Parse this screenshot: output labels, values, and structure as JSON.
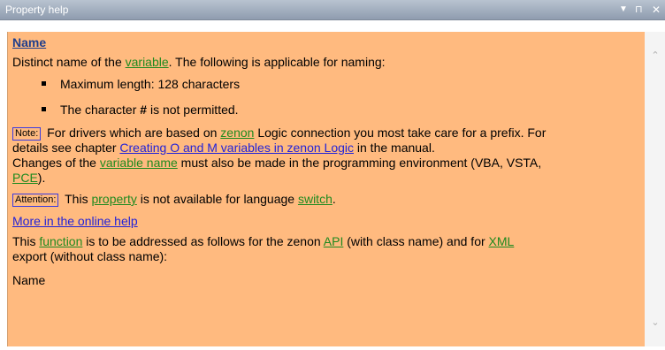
{
  "window": {
    "title": "Property help",
    "dropdown_glyph": "▼",
    "pin_glyph": "⊓",
    "close_glyph": "✕"
  },
  "help": {
    "heading": "Name",
    "intro_pre": "Distinct name of the ",
    "intro_link": "variable",
    "intro_post": ". The following is applicable for naming:",
    "bullet1": "Maximum length: 128 characters",
    "bullet2_pre": "The character ",
    "bullet2_char": "#",
    "bullet2_post": " is not permitted.",
    "note_tag": "Note:",
    "note_pre": " For drivers which are based on ",
    "note_link": "zenon",
    "note_post": " Logic connection you most take care for a prefix. For",
    "note_line2_pre": "details see chapter ",
    "note_line2_link": "Creating O and M variables in zenon Logic",
    "note_line2_post": " in the manual.",
    "changes_pre": "Changes of the ",
    "changes_link": "variable name",
    "changes_post": " must also be made in the programming environment (VBA, VSTA,",
    "changes_line2_link": "PCE",
    "changes_line2_post": ").",
    "attention_tag": "Attention:",
    "attention_pre": " This ",
    "attention_link1": "property",
    "attention_mid": " is not available for language ",
    "attention_link2": "switch",
    "attention_post": ".",
    "online_help": "More in the online help",
    "func_pre": "This ",
    "func_link": "function",
    "func_mid": " is to be addressed as follows for the zenon ",
    "func_link2": "API",
    "func_mid2": " (with class name) and for ",
    "func_link3": "XML",
    "func_line2": "export (without class name):",
    "api_name": "Name"
  },
  "scrollbar": {
    "up_glyph": "⌃",
    "down_glyph": "⌄"
  }
}
